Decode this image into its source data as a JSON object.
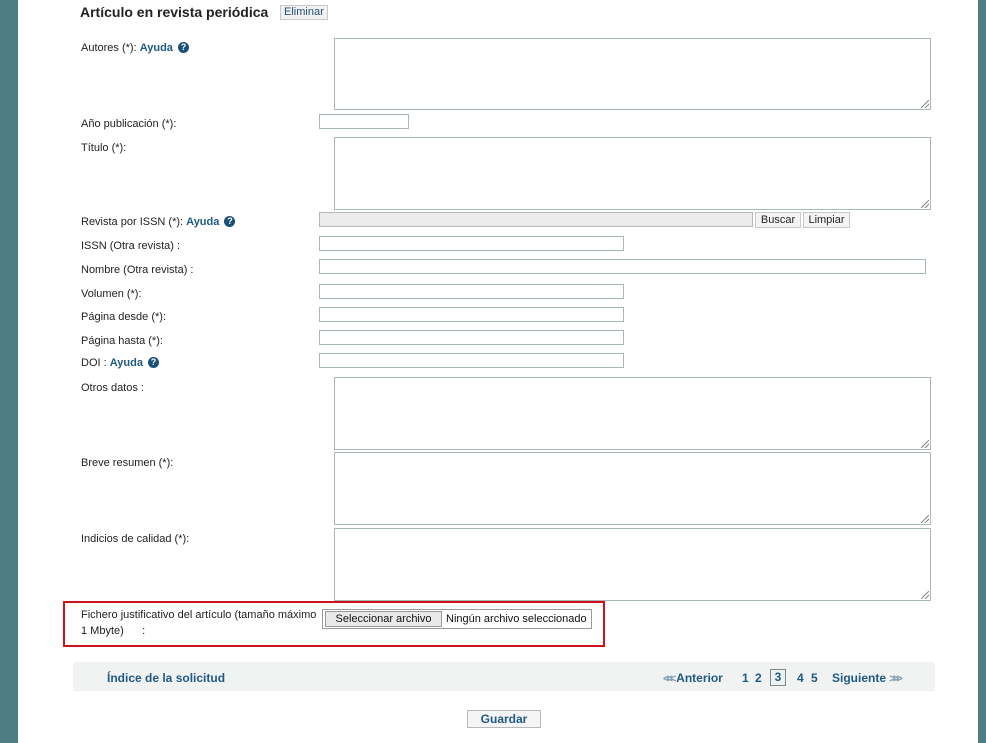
{
  "section": {
    "title": "Artículo en revista periódica",
    "delete_label": "Eliminar"
  },
  "help_label": "Ayuda",
  "fields": {
    "autores": "Autores (*):",
    "anio": "Año publicación (*):",
    "titulo": "Título (*):",
    "revista_issn": "Revista por ISSN (*):",
    "issn_otra": "ISSN (Otra revista) :",
    "nombre_otra": "Nombre (Otra revista) :",
    "volumen": "Volumen (*):",
    "pag_desde": "Página desde (*):",
    "pag_hasta": "Página hasta (*):",
    "doi": "DOI :",
    "otros_datos": "Otros datos :",
    "breve_resumen": "Breve resumen (*):",
    "indicios": "Indicios de calidad (*):",
    "fichero_line1": "Fichero justificativo del artículo (tamaño máximo",
    "fichero_line2": "1 Mbyte)      :"
  },
  "buttons": {
    "buscar": "Buscar",
    "limpiar": "Limpiar",
    "file_select": "Seleccionar archivo",
    "file_none": "Ningún archivo seleccionado",
    "guardar": "Guardar"
  },
  "nav": {
    "index": "Índice de la solicitud",
    "prev": "Anterior",
    "next": "Siguiente",
    "pages": [
      "1",
      "2",
      "3",
      "4",
      "5"
    ],
    "current_page": "3"
  },
  "colors": {
    "background": "#4e7c83",
    "link": "#1f5a84",
    "highlight": "#d0121e"
  }
}
